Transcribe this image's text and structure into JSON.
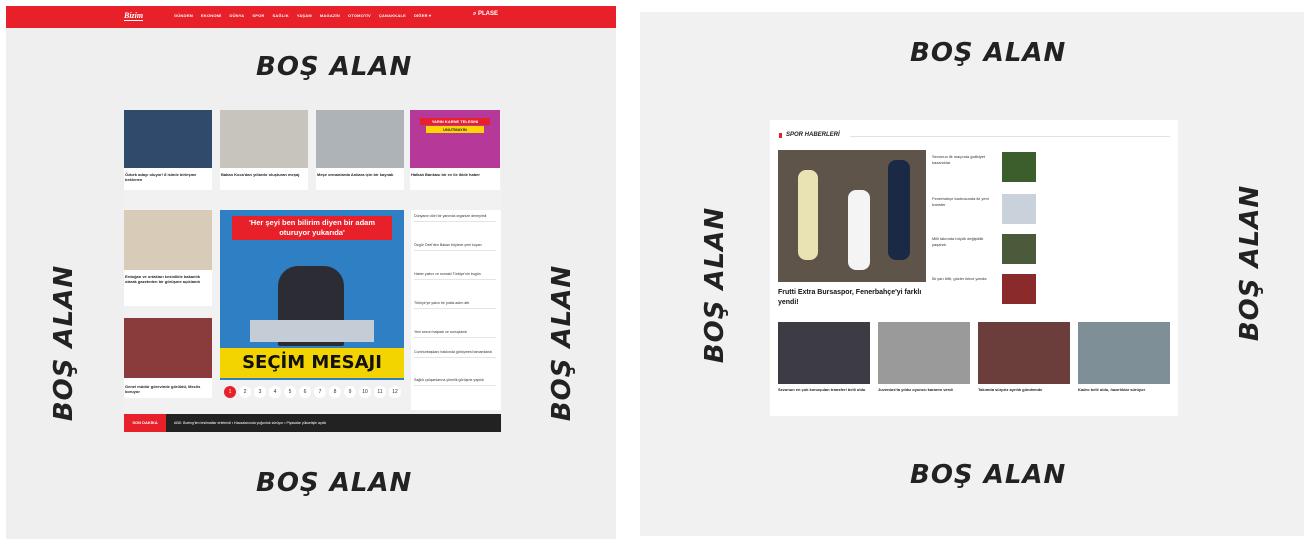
{
  "left": {
    "nav": {
      "logo": "Bizim",
      "items": [
        "GÜNDEM",
        "EKONOMİ",
        "DÜNYA",
        "SPOR",
        "SAĞLIK",
        "YAŞAM",
        "MAGAZİN",
        "OTOMOTİV",
        "ÇANAKKALE",
        "DİĞER ▾"
      ],
      "search_label": "⌕  PLASE"
    },
    "bos_alan": "BOŞ ALAN",
    "cards": [
      {
        "caption": "Özbek adayı oluyor! 8 isimle birleşme beklenen"
      },
      {
        "caption": "Bakan Koca'dan yıllardır oluşturan meşaj"
      },
      {
        "caption": "Meşe ormanlarda Ankara için bir kaynak"
      },
      {
        "caption": "Halkalı Bankası bir ev ile ikide haber"
      },
      {
        "caption": "Erdoğan ve ortakları kesinlikle bakanlık olarak gazeteden bir görüşme açıklandı"
      },
      {
        "caption": "Genel müdür görevinde görüldü, Meclis koruyor"
      }
    ],
    "promo": {
      "line1": "YARIN KARNE TELESINI",
      "line2": "UNUTMAYIN"
    },
    "main_story": {
      "headline": "'Her şeyi ben bilirim diyen bir adam oturuyor yukarıda'",
      "banner": "SEÇİM MESAJI"
    },
    "list_items": [
      "Dünyanın dört bir yanında organize deneyimli",
      "Özgür Özel'den Bakan böylece yeni koyan",
      "Haber yalnız ve sonraki Türkiye'nin bugün",
      "Türkiye'ye yakın bir yolda adım attı",
      "Yeni sezon başladı ve sonuçlandı",
      "Cumhurbaşkanı hakkında görüşmesi tamamlandı",
      "Sağlık çalışanlarına yönelik görüşme yapıldı"
    ],
    "pages": [
      "1",
      "2",
      "3",
      "4",
      "5",
      "6",
      "7",
      "8",
      "9",
      "10",
      "11",
      "12"
    ],
    "ticker": {
      "label": "SON DAKİKA",
      "text": "ABD: Boeing'ten teslimatlar ertelendi • Havaalanında yoğunluk sürüyor • Piyasalar yükselişle açıldı"
    }
  },
  "right": {
    "bos_alan": "BOŞ ALAN",
    "sport": {
      "title": "SPOR HABERLERİ",
      "headline": "Frutti Extra Bursaspor, Fenerbahçe'yi farklı yendi!",
      "side_items": [
        "Sezonun ilk maçında galibiyet kazandılar",
        "Fenerbahçe kadrosunda iki yeni transfer",
        "Milli takımda büyük değişiklik yaşandı",
        "İlk yarı bitti, gözler ikinci yarıda"
      ],
      "bottom_items": [
        "Sezonun en çok konuşulan transferi belli oldu",
        "Juventus'ta yıldız oyuncu kararını verdi",
        "Takımda sürpriz ayrılık gündemde",
        "Kadro belli oldu, hazırlıklar sürüyor"
      ]
    }
  },
  "colors": {
    "accent": "#e8202a",
    "panel_bg": "#efefef",
    "text": "#222222"
  }
}
